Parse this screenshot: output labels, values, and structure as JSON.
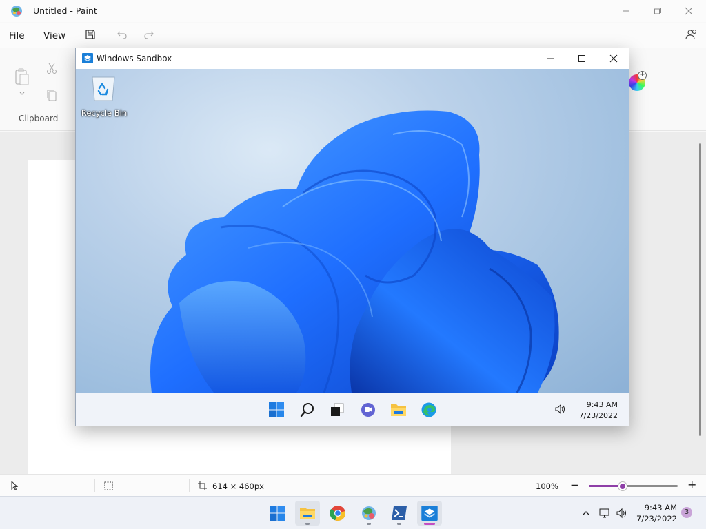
{
  "paint": {
    "title": "Untitled - Paint",
    "menu": {
      "file": "File",
      "view": "View"
    },
    "ribbon": {
      "clipboard_label": "Clipboard"
    },
    "status": {
      "canvas_size": "614 × 460px",
      "zoom_label": "100%",
      "zoom_minus": "−",
      "zoom_plus": "+",
      "zoom_slider_fraction": 0.38
    }
  },
  "sandbox": {
    "title": "Windows Sandbox",
    "desktop": {
      "recycle_bin_label": "Recycle Bin"
    },
    "clock": {
      "time": "9:43 AM",
      "date": "7/23/2022"
    }
  },
  "taskbar": {
    "clock": {
      "time": "9:43 AM",
      "date": "7/23/2022"
    },
    "notification_count": "3"
  },
  "colors": {
    "accent_purple": "#8e3fa7",
    "win_blue": "#0a6cd4",
    "bloom_blue": "#1f6fff"
  }
}
